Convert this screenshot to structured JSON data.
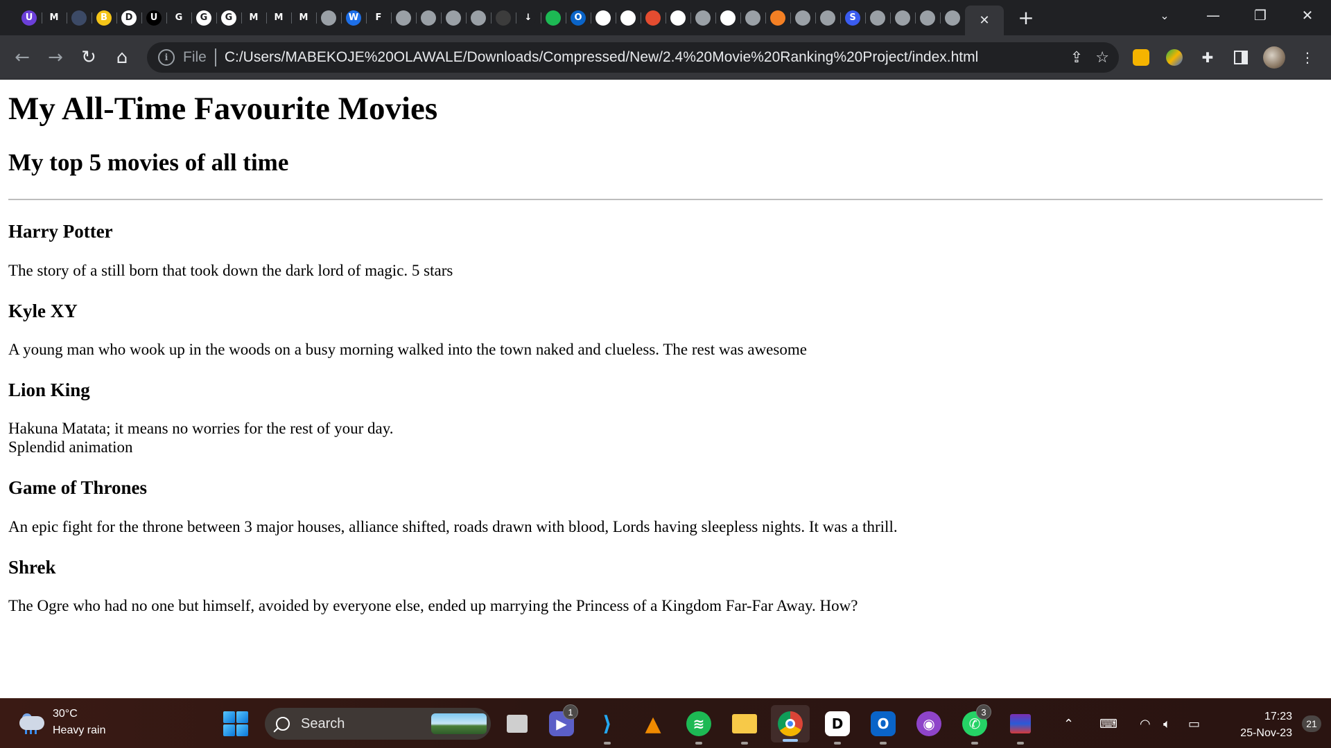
{
  "browser": {
    "tabs": [
      {
        "icon": "tab-favicon-u",
        "glyph": "U",
        "bg": "#6b3fd8"
      },
      {
        "icon": "tab-favicon-m",
        "glyph": "M",
        "bg": "#202124"
      },
      {
        "icon": "tab-favicon-doc",
        "glyph": "",
        "bg": "#3c4a66"
      },
      {
        "icon": "tab-favicon-b",
        "glyph": "B",
        "bg": "#f5c518"
      },
      {
        "icon": "tab-favicon-d",
        "glyph": "D",
        "bg": "#ffffff"
      },
      {
        "icon": "tab-favicon-u-dark",
        "glyph": "U",
        "bg": "#000000"
      },
      {
        "icon": "tab-favicon-g",
        "glyph": "G",
        "bg": "#202124"
      },
      {
        "icon": "tab-favicon-google",
        "glyph": "G",
        "bg": "#ffffff"
      },
      {
        "icon": "tab-favicon-google-2",
        "glyph": "G",
        "bg": "#ffffff"
      },
      {
        "icon": "tab-favicon-gmail",
        "glyph": "M",
        "bg": "#202124"
      },
      {
        "icon": "tab-favicon-gmail-2",
        "glyph": "M",
        "bg": "#202124"
      },
      {
        "icon": "tab-favicon-gmail-3",
        "glyph": "M",
        "bg": "#202124"
      },
      {
        "icon": "tab-favicon-globe",
        "glyph": "",
        "bg": "#9aa0a6"
      },
      {
        "icon": "tab-favicon-w",
        "glyph": "W",
        "bg": "#1d6fe8"
      },
      {
        "icon": "tab-favicon-figma",
        "glyph": "F",
        "bg": "#202124"
      },
      {
        "icon": "tab-favicon-globe-2",
        "glyph": "",
        "bg": "#9aa0a6"
      },
      {
        "icon": "tab-favicon-globe-3",
        "glyph": "",
        "bg": "#9aa0a6"
      },
      {
        "icon": "tab-favicon-globe-4",
        "glyph": "",
        "bg": "#9aa0a6"
      },
      {
        "icon": "tab-favicon-globe-5",
        "glyph": "",
        "bg": "#9aa0a6"
      },
      {
        "icon": "tab-favicon-github-dim",
        "glyph": "",
        "bg": "#3c3c3c"
      },
      {
        "icon": "tab-favicon-download",
        "glyph": "↓",
        "bg": "#202124"
      },
      {
        "icon": "tab-favicon-spotify",
        "glyph": "",
        "bg": "#1db954"
      },
      {
        "icon": "tab-favicon-outlook",
        "glyph": "O",
        "bg": "#0a64c8"
      },
      {
        "icon": "tab-favicon-github",
        "glyph": "",
        "bg": "#ffffff"
      },
      {
        "icon": "tab-favicon-github-2",
        "glyph": "",
        "bg": "#ffffff"
      },
      {
        "icon": "tab-favicon-git",
        "glyph": "",
        "bg": "#e44c30"
      },
      {
        "icon": "tab-favicon-github-3",
        "glyph": "",
        "bg": "#ffffff"
      },
      {
        "icon": "tab-favicon-globe-6",
        "glyph": "",
        "bg": "#9aa0a6"
      },
      {
        "icon": "tab-favicon-github-4",
        "glyph": "",
        "bg": "#ffffff"
      },
      {
        "icon": "tab-favicon-globe-7",
        "glyph": "",
        "bg": "#9aa0a6"
      },
      {
        "icon": "tab-favicon-stackoverflow",
        "glyph": "",
        "bg": "#f48024"
      },
      {
        "icon": "tab-favicon-globe-8",
        "glyph": "",
        "bg": "#9aa0a6"
      },
      {
        "icon": "tab-favicon-globe-9",
        "glyph": "",
        "bg": "#9aa0a6"
      },
      {
        "icon": "tab-favicon-s",
        "glyph": "S",
        "bg": "#3a5cf0"
      },
      {
        "icon": "tab-favicon-globe-10",
        "glyph": "",
        "bg": "#9aa0a6"
      },
      {
        "icon": "tab-favicon-globe-11",
        "glyph": "",
        "bg": "#9aa0a6"
      },
      {
        "icon": "tab-favicon-globe-12",
        "glyph": "",
        "bg": "#9aa0a6"
      },
      {
        "icon": "tab-favicon-globe-13",
        "glyph": "",
        "bg": "#9aa0a6"
      }
    ],
    "active_tab_close": "✕",
    "new_tab": "+",
    "address": {
      "scheme": "File",
      "url": "C:/Users/MABEKOJE%20OLAWALE/Downloads/Compressed/New/2.4%20Movie%20Ranking%20Project/index.html"
    }
  },
  "page": {
    "title": "My All-Time Favourite Movies",
    "subtitle": "My top 5 movies of all time",
    "movies": [
      {
        "name": "Harry Potter",
        "lines": [
          "The story of a still born that took down the dark lord of magic. 5 stars"
        ]
      },
      {
        "name": "Kyle XY",
        "lines": [
          "A young man who wook up in the woods on a busy morning walked into the town naked and clueless. The rest was awesome"
        ]
      },
      {
        "name": "Lion King",
        "lines": [
          "Hakuna Matata; it means no worries for the rest of your day.",
          "Splendid animation"
        ]
      },
      {
        "name": "Game of Thrones",
        "lines": [
          "An epic fight for the throne between 3 major houses, alliance shifted, roads drawn with blood, Lords having sleepless nights. It was a thrill."
        ]
      },
      {
        "name": "Shrek",
        "lines": [
          "The Ogre who had no one but himself, avoided by everyone else, ended up marrying the Princess of a Kingdom Far-Far Away. How?"
        ]
      }
    ]
  },
  "taskbar": {
    "weather": {
      "temp": "30°C",
      "condition": "Heavy rain"
    },
    "search_label": "Search",
    "badges": {
      "teams": "1",
      "whatsapp": "3"
    },
    "clock": {
      "time": "17:23",
      "date": "25-Nov-23"
    },
    "notifications": "21"
  }
}
